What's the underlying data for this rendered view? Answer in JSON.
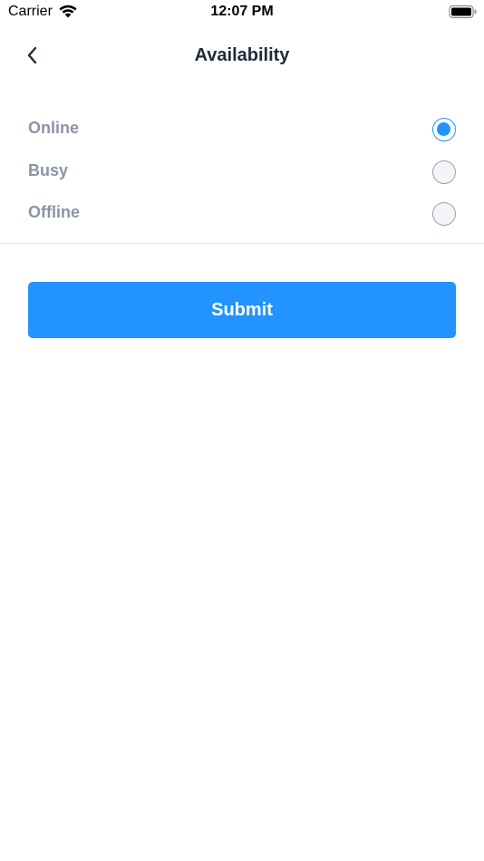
{
  "status_bar": {
    "carrier": "Carrier",
    "time": "12:07 PM",
    "wifi_icon": "wifi-icon",
    "battery_icon": "battery-icon"
  },
  "nav": {
    "back_icon": "chevron-left-icon",
    "title": "Availability"
  },
  "options": [
    {
      "label": "Online",
      "selected": true
    },
    {
      "label": "Busy",
      "selected": false
    },
    {
      "label": "Offline",
      "selected": false
    }
  ],
  "submit_label": "Submit",
  "colors": {
    "accent": "#2393ff",
    "title": "#1f2a3c",
    "option_label": "#8a94a6",
    "divider": "#e3e6ea"
  }
}
